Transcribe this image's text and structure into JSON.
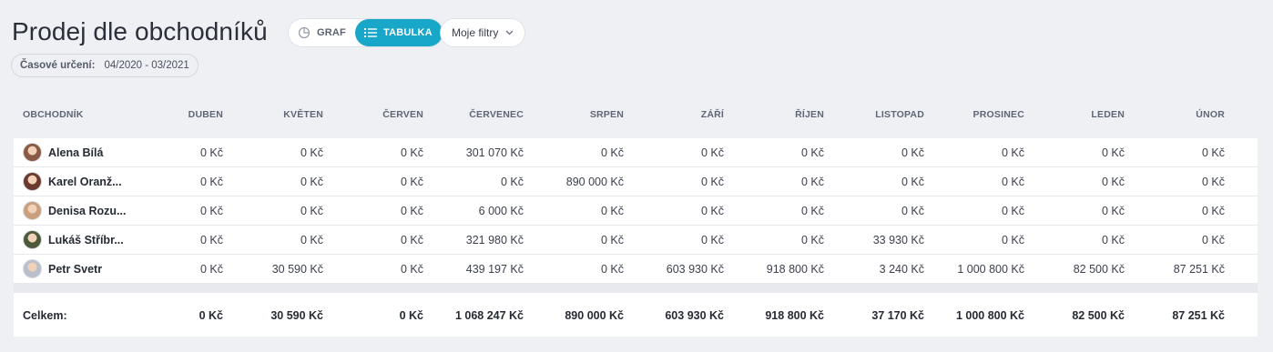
{
  "page": {
    "title": "Prodej dle obchodníků"
  },
  "view_toggle": {
    "graf_label": "GRAF",
    "tabulka_label": "TABULKA",
    "active": "TABULKA"
  },
  "filters": {
    "label": "Moje filtry"
  },
  "period": {
    "label": "Časové určení:",
    "value": "04/2020 - 03/2021"
  },
  "table": {
    "columns": [
      "OBCHODNÍK",
      "DUBEN",
      "KVĚTEN",
      "ČERVEN",
      "ČERVENEC",
      "SRPEN",
      "ZÁŘÍ",
      "ŘÍJEN",
      "LISTOPAD",
      "PROSINEC",
      "LEDEN",
      "ÚNOR"
    ],
    "rows": [
      {
        "name": "Alena Bílá",
        "avatar_color": "#8a5a44",
        "values": [
          "0 Kč",
          "0 Kč",
          "0 Kč",
          "301 070 Kč",
          "0 Kč",
          "0 Kč",
          "0 Kč",
          "0 Kč",
          "0 Kč",
          "0 Kč",
          "0 Kč"
        ]
      },
      {
        "name": "Karel Oranž...",
        "avatar_color": "#6b3a2e",
        "values": [
          "0 Kč",
          "0 Kč",
          "0 Kč",
          "0 Kč",
          "890 000 Kč",
          "0 Kč",
          "0 Kč",
          "0 Kč",
          "0 Kč",
          "0 Kč",
          "0 Kč"
        ]
      },
      {
        "name": "Denisa Rozu...",
        "avatar_color": "#c9a07e",
        "values": [
          "0 Kč",
          "0 Kč",
          "0 Kč",
          "6 000 Kč",
          "0 Kč",
          "0 Kč",
          "0 Kč",
          "0 Kč",
          "0 Kč",
          "0 Kč",
          "0 Kč"
        ]
      },
      {
        "name": "Lukáš Stříbr...",
        "avatar_color": "#4d5a3a",
        "values": [
          "0 Kč",
          "0 Kč",
          "0 Kč",
          "321 980 Kč",
          "0 Kč",
          "0 Kč",
          "0 Kč",
          "33 930 Kč",
          "0 Kč",
          "0 Kč",
          "0 Kč"
        ]
      },
      {
        "name": "Petr Svetr",
        "avatar_color": "#b9c0cc",
        "values": [
          "0 Kč",
          "30 590 Kč",
          "0 Kč",
          "439 197 Kč",
          "0 Kč",
          "603 930 Kč",
          "918 800 Kč",
          "3 240 Kč",
          "1 000 800 Kč",
          "82 500 Kč",
          "87 251 Kč"
        ]
      }
    ],
    "total": {
      "label": "Celkem:",
      "values": [
        "0 Kč",
        "30 590 Kč",
        "0 Kč",
        "1 068 247 Kč",
        "890 000 Kč",
        "603 930 Kč",
        "918 800 Kč",
        "37 170 Kč",
        "1 000 800 Kč",
        "82 500 Kč",
        "87 251 Kč"
      ]
    }
  },
  "colors": {
    "accent": "#19a7c9",
    "background": "#eef0f4"
  },
  "icons": {
    "graf": "pie-chart-icon",
    "tabulka": "list-icon",
    "filters": "chevron-down-icon"
  }
}
